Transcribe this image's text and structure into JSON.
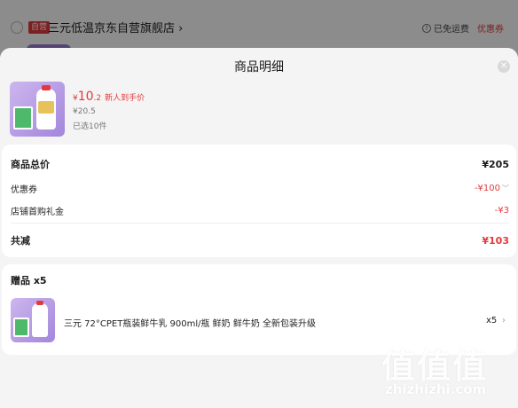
{
  "background": {
    "badge": "自营",
    "store_name": "三元低温京东自营旗舰店 ›",
    "shipping_icon": "info-circle-icon",
    "shipping": "已免运费",
    "coupon": "优惠券"
  },
  "sheet": {
    "title": "商品明细",
    "close_icon": "close-icon"
  },
  "product": {
    "price_symbol": "¥",
    "price_int": "10",
    "price_dec": ".2",
    "price_tag": "新人到手价",
    "orig_price": "¥20.5",
    "selected": "已选10件"
  },
  "price_card": {
    "total_label": "商品总价",
    "total_value": "¥205",
    "coupon_label": "优惠券",
    "coupon_value": "-¥100",
    "gift_money_label": "店铺首购礼金",
    "gift_money_value": "-¥3",
    "reduce_label": "共减",
    "reduce_value": "¥103"
  },
  "gift_card": {
    "title": "赠品 x5",
    "item_name": "三元 72°CPET瓶装鲜牛乳 900ml/瓶 鲜奶 鲜牛奶 全新包装升级",
    "item_qty": "x5"
  },
  "watermark": {
    "glyphs": "值值值",
    "url": "zhizhizhi.com"
  },
  "colors": {
    "accent": "#e4393c",
    "background": "#f4f4f4",
    "card": "#ffffff"
  }
}
